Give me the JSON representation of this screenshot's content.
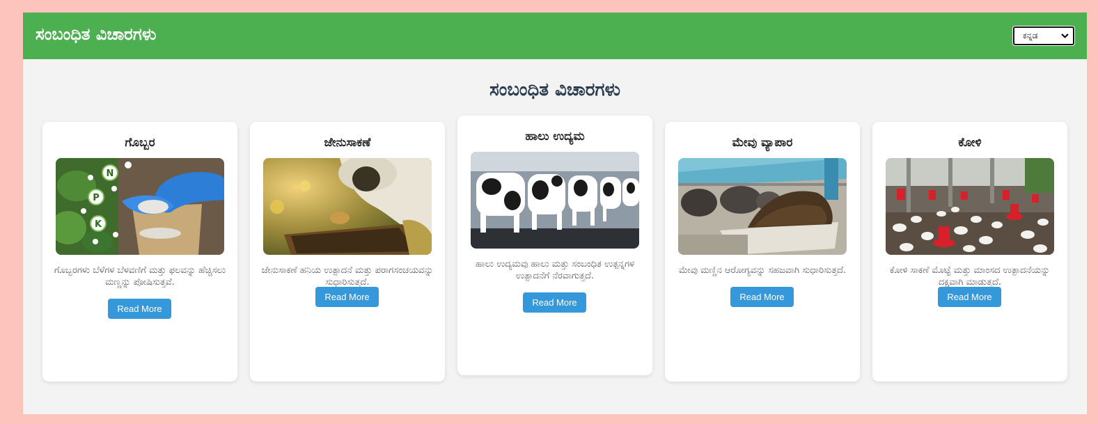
{
  "header": {
    "title": "ಸಂಬಂಧಿತ ವಿಚಾರಗಳು",
    "language_selected": "ಕನ್ನಡ"
  },
  "section": {
    "title": "ಸಂಬಂಧಿತ ವಿಚಾರಗಳು"
  },
  "cards": [
    {
      "title": "ಗೊಬ್ಬರ",
      "description": "ಗೊಬ್ಬರಗಳು ಬೆಳೆಗಳ ಬೆಳವಣಿಗೆ ಮತ್ತು ಫಲವನ್ನು ಹೆಚ್ಚಿಸಲು ಮಣ್ಣನ್ನು ಪೋಷಿಸುತ್ತವೆ.",
      "button": "Read More",
      "image_labels": [
        "N",
        "P",
        "K"
      ]
    },
    {
      "title": "ಜೇನುಸಾಕಣೆ",
      "description": "ಜೇನುಸಾಕಣೆ ಹನಿಯ ಉತ್ಪಾದನೆ ಮತ್ತು ಪರಾಗಸಂಚಯವನ್ನು ಸುಧಾರಿಸುತ್ತದೆ.",
      "button": "Read More"
    },
    {
      "title": "ಹಾಲು ಉದ್ಯಮ",
      "description": "ಹಾಲು ಉದ್ಯಮವು ಹಾಲು ಮತ್ತು ಸಂಬಂಧಿತ ಉತ್ಪನ್ನಗಳ ಉತ್ಪಾದನೆಗೆ ನೆರವಾಗುತ್ತದೆ.",
      "button": "Read More"
    },
    {
      "title": "ಮೇವು ವ್ಯಾಪಾರ",
      "description": "ಮೇವು ಮಣ್ಣಿನ ಆರೋಗ್ಯವನ್ನು ಸಹಜವಾಗಿ ಸುಧಾರಿಸುತ್ತದೆ.",
      "button": "Read More"
    },
    {
      "title": "ಕೋಳಿ",
      "description": "ಕೋಳಿ ಸಾಕಣೆ ಮೊಟ್ಟೆ ಮತ್ತು ಮಾಂಸದ ಉತ್ಪಾದನೆಯನ್ನು ದಕ್ಷವಾಗಿ ಮಾಡುತ್ತದೆ.",
      "button": "Read More"
    }
  ],
  "colors": {
    "page_background": "#fcc4bd",
    "header": "#4caf50",
    "content_background": "#f3f3f3",
    "button": "#3498db",
    "heading": "#2c3e50"
  }
}
